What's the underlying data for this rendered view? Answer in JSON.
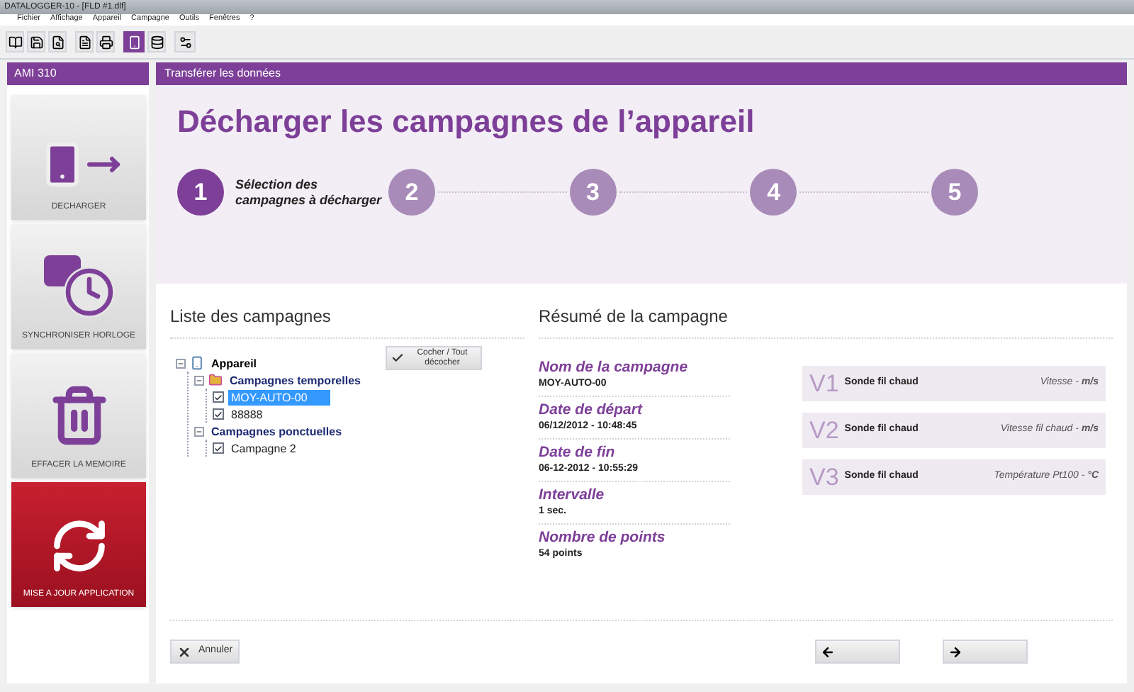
{
  "window": {
    "title": "DATALOGGER-10 - [FLD #1.dlf]"
  },
  "menu": [
    "Fichier",
    "Affichage",
    "Appareil",
    "Campagne",
    "Outils",
    "Fenêtres",
    "?"
  ],
  "sidebar": {
    "title": "AMI 310",
    "items": [
      {
        "label": "DECHARGER",
        "kind": "download",
        "accent": false
      },
      {
        "label": "SYNCHRONISER HORLOGE",
        "kind": "clock",
        "accent": false
      },
      {
        "label": "EFFACER LA MEMOIRE",
        "kind": "erase",
        "accent": false
      },
      {
        "label": "MISE A JOUR APPLICATION",
        "kind": "update",
        "accent": true
      }
    ]
  },
  "panel": {
    "title": "Transférer les données",
    "heading": "Décharger les campagnes de l’appareil"
  },
  "steps": [
    {
      "number": "1",
      "label": "Sélection des campagnes à décharger",
      "selected": true
    },
    {
      "number": "2",
      "selected": false
    },
    {
      "number": "3",
      "selected": false
    },
    {
      "number": "4",
      "selected": false
    },
    {
      "number": "5",
      "selected": false
    }
  ],
  "campaign_list": {
    "title": "Liste des campagnes",
    "toggle_button": "Cocher / Tout décocher",
    "tree": [
      {
        "label": "Appareil",
        "kind": "device",
        "expanded": true,
        "children": [
          {
            "label": "Campagnes temporelles",
            "kind": "folder",
            "expanded": true,
            "children": [
              {
                "label": "MOY-AUTO-00",
                "kind": "campaign",
                "checked": true,
                "selected": true
              },
              {
                "label": "88888",
                "kind": "campaign",
                "checked": true,
                "selected": false
              }
            ]
          },
          {
            "label": "Campagnes ponctuelles",
            "kind": "group",
            "expanded": true,
            "children": [
              {
                "label": "Campagne 2",
                "kind": "campaign",
                "checked": true,
                "selected": false
              }
            ]
          }
        ]
      }
    ]
  },
  "summary": {
    "title": "Résumé de la campagne",
    "fields": [
      {
        "label": "Nom de la campagne",
        "value": "MOY-AUTO-00"
      },
      {
        "label": "Date de départ",
        "value": "06/12/2012 - 10:48:45"
      },
      {
        "label": "Date de fin",
        "value": "06-12-2012 - 10:55:29"
      },
      {
        "label": "Intervalle",
        "value": "1 sec."
      },
      {
        "label": "Nombre de points",
        "value": "54 points"
      }
    ],
    "channels": [
      {
        "code": "V1",
        "sensor": "Sonde fil chaud",
        "measure": "Vitesse - **m/s**"
      },
      {
        "code": "V2",
        "sensor": "Sonde fil chaud",
        "measure": "Vitesse fil chaud - **m/s**"
      },
      {
        "code": "V3",
        "sensor": "Sonde fil chaud",
        "measure": "Température Pt100 - **°C**"
      }
    ]
  },
  "cancel_button": "Annuler"
}
